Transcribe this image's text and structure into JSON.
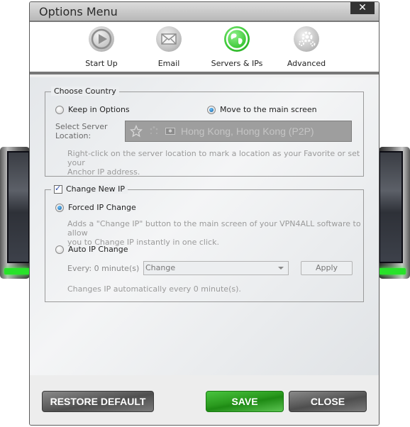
{
  "window": {
    "title": "Options Menu",
    "close_glyph": "✕"
  },
  "toolbar": {
    "tabs": [
      {
        "label": "Start Up",
        "icon": "play-icon",
        "active": false
      },
      {
        "label": "Email",
        "icon": "envelope-icon",
        "active": false
      },
      {
        "label": "Servers & IPs",
        "icon": "globe-icon",
        "active": true
      },
      {
        "label": "Advanced",
        "icon": "gears-icon",
        "active": false
      }
    ]
  },
  "choose_country": {
    "legend": "Choose Country",
    "option_keep": "Keep in Options",
    "option_move": "Move to the main screen",
    "selected": "move",
    "server_label_line1": "Select Server",
    "server_label_line2": "Location:",
    "server_value": "Hong Kong, Hong Kong (P2P)",
    "flag_glyph": "✱",
    "hint_line1": "Right-click on the server location to mark a location as your Favorite or set your",
    "hint_line2": "Anchor IP address."
  },
  "change_ip": {
    "legend": "Change New IP",
    "enabled": true,
    "forced_label": "Forced IP Change",
    "forced_desc_line1": "Adds a \"Change IP\" button to the main screen of your VPN4ALL software to allow",
    "forced_desc_line2": "you to Change IP instantly in one click.",
    "auto_label": "Auto IP Change",
    "selected": "forced",
    "every_label": "Every: 0 minute(s)",
    "interval_select": "Change",
    "apply_label": "Apply",
    "auto_desc": "Changes IP automatically every 0 minute(s)."
  },
  "footer": {
    "restore_label": "RESTORE DEFAULT",
    "save_label": "SAVE",
    "close_label": "CLOSE"
  },
  "colors": {
    "accent_green": "#2a9a1e",
    "led_green": "#28e22a",
    "radio_selected": "#0a5a9a"
  }
}
